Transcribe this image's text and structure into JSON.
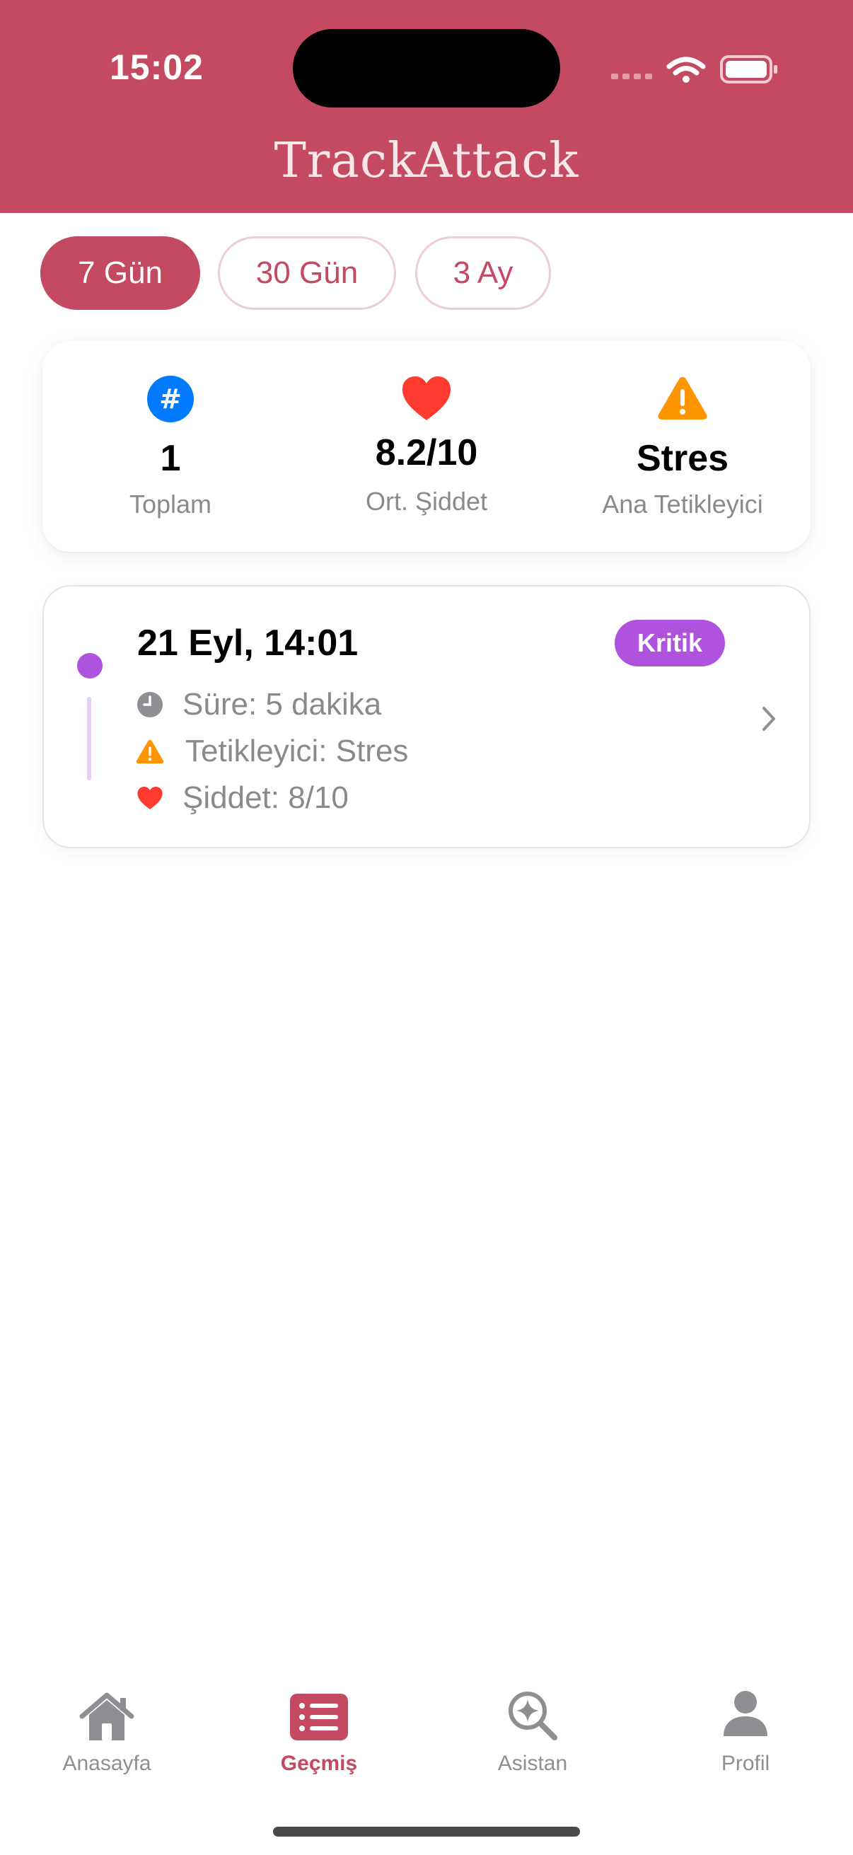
{
  "status_bar": {
    "time": "15:02"
  },
  "app": {
    "title": "TrackAttack"
  },
  "filters": [
    {
      "label": "7 Gün",
      "active": true
    },
    {
      "label": "30 Gün",
      "active": false
    },
    {
      "label": "3 Ay",
      "active": false
    }
  ],
  "summary": {
    "total": {
      "value": "1",
      "label": "Toplam",
      "icon": "hash-icon"
    },
    "severity": {
      "value": "8.2/10",
      "label": "Ort. Şiddet",
      "icon": "heart-icon"
    },
    "trigger": {
      "value": "Stres",
      "label": "Ana Tetikleyici",
      "icon": "warning-icon"
    }
  },
  "attacks": [
    {
      "date": "21 Eyl, 14:01",
      "badge": "Kritik",
      "duration": "Süre: 5 dakika",
      "trigger": "Tetikleyici: Stres",
      "severity": "Şiddet: 8/10"
    }
  ],
  "tabs": [
    {
      "label": "Anasayfa",
      "icon": "house-icon",
      "active": false
    },
    {
      "label": "Geçmiş",
      "icon": "list-icon",
      "active": true
    },
    {
      "label": "Asistan",
      "icon": "sparkle-search-icon",
      "active": false
    },
    {
      "label": "Profil",
      "icon": "person-icon",
      "active": false
    }
  ],
  "colors": {
    "brand": "#C34A60",
    "critical": "#AF52DE",
    "heart": "#FF3B30",
    "warning": "#FF9500",
    "info": "#007AFF"
  }
}
